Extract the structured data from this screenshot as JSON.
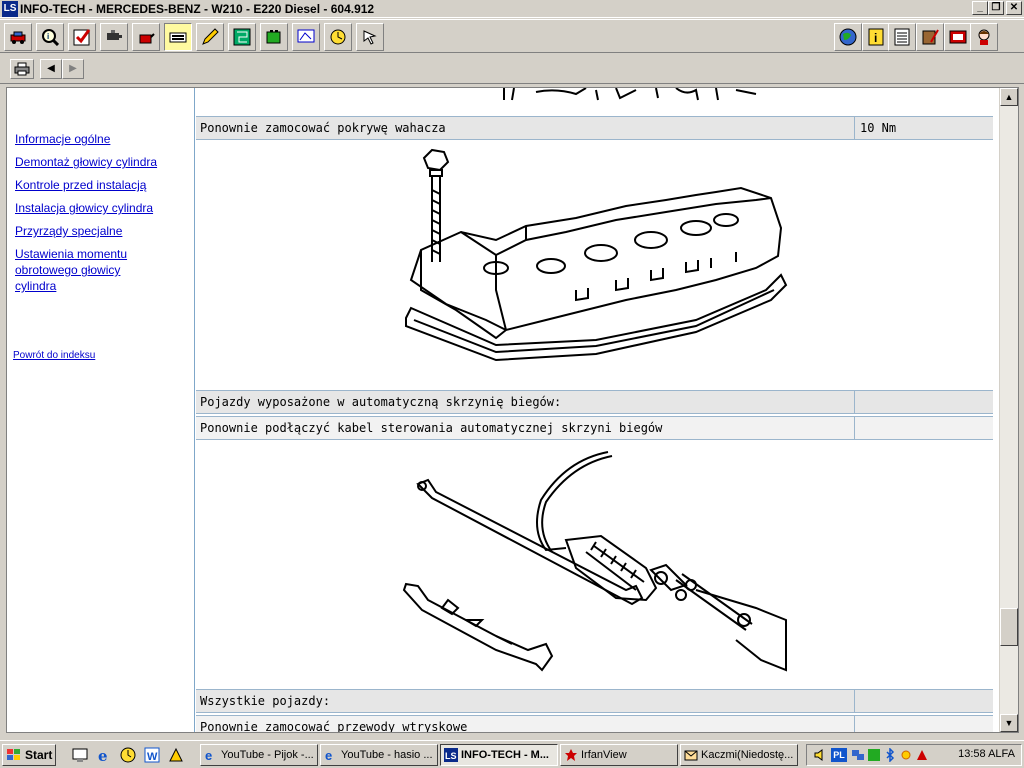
{
  "window": {
    "logo_text": "LS",
    "title": "INFO-TECH - MERCEDES-BENZ - W210 - E220 Diesel - 604.912",
    "controls": [
      "_",
      "❐",
      "✕"
    ]
  },
  "toolbar": {
    "left_tools": [
      "car-icon",
      "magnifier-info-icon",
      "checklist-icon",
      "spark-plug-icon",
      "oil-can-icon",
      "keyboard-icon",
      "pencil-icon",
      "circuit-board-icon",
      "battery-icon",
      "monitor-diagram-icon",
      "clock-icon",
      "pointer-icon"
    ],
    "right_tools": [
      "globe-icon",
      "info-icon",
      "notes-icon",
      "book-pencil-icon",
      "film-icon",
      "help-person-icon"
    ]
  },
  "nav": {
    "print_icon": "printer-icon",
    "back": "◀",
    "forward": "▶"
  },
  "sidebar": {
    "links": [
      "Informacje ogólne",
      "Demontaż głowicy cylindra",
      "Kontrole przed instalacją",
      "Instalacja głowicy cylindra",
      "Przyrządy specjalne",
      "Ustawienia momentu obrotowego głowicy cylindra"
    ],
    "back_link": "Powrót do indeksu"
  },
  "main": {
    "rows": [
      {
        "text": "Ponownie zamocować pokrywę wahacza",
        "value": "10 Nm"
      },
      {
        "text": "Pojazdy wyposażone w automatyczną skrzynię biegów:",
        "value": ""
      },
      {
        "text": "Ponownie podłączyć kabel sterowania automatycznej skrzyni biegów",
        "value": ""
      },
      {
        "text": "Wszystkie pojazdy:",
        "value": ""
      },
      {
        "text": "Ponownie zamocować przewody wtryskowe",
        "value": ""
      }
    ]
  },
  "taskbar": {
    "start": "Start",
    "quick_launch": [
      "desktop-icon",
      "ie-icon",
      "clock-icon",
      "word-icon",
      "winamp-icon"
    ],
    "tasks": [
      {
        "label": "YouTube - Pijok -...",
        "icon": "ie-icon"
      },
      {
        "label": "YouTube - hasio ...",
        "icon": "ie-icon"
      },
      {
        "label": "INFO-TECH - M...",
        "icon": "infotech-icon",
        "active": true
      },
      {
        "label": "IrfanView",
        "icon": "irfanview-icon"
      },
      {
        "label": "Kaczmi(Niedostę...",
        "icon": "mail-icon"
      }
    ],
    "tray_lang": "PL",
    "clock": "13:58 ALFA"
  }
}
